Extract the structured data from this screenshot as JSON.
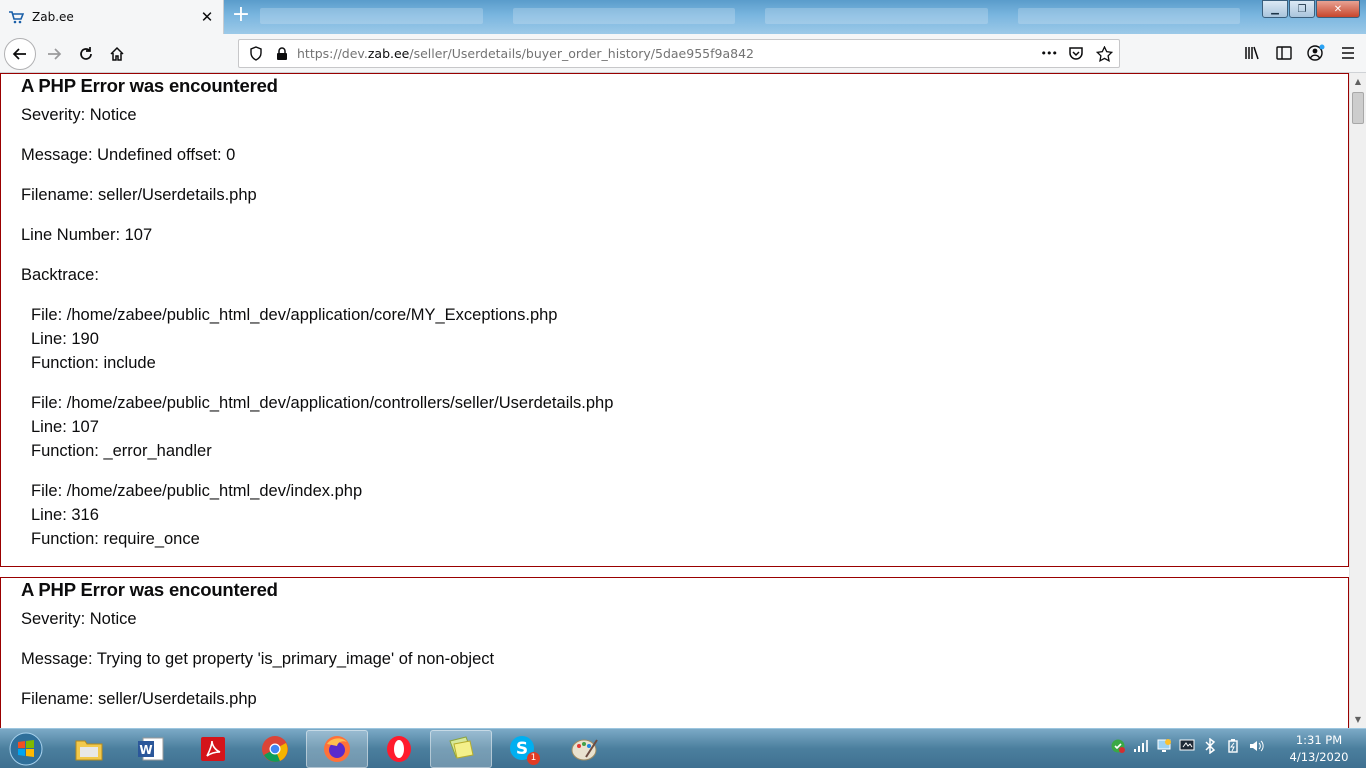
{
  "browser": {
    "tab": {
      "title": "Zab.ee",
      "close": "✕"
    },
    "new_tab": "+",
    "url_prefix": "https://dev.",
    "url_host": "zab.ee",
    "url_path": "/seller/Userdetails/buyer_order_history/5dae955f9a842",
    "url_more": "•••"
  },
  "errors": [
    {
      "heading": "A PHP Error was encountered",
      "severity": "Severity: Notice",
      "message": "Message: Undefined offset: 0",
      "filename": "Filename: seller/Userdetails.php",
      "line_number": "Line Number: 107",
      "backtrace_label": "Backtrace:",
      "backtrace": [
        {
          "file": "File: /home/zabee/public_html_dev/application/core/MY_Exceptions.php",
          "line": "Line: 190",
          "function": "Function: include"
        },
        {
          "file": "File: /home/zabee/public_html_dev/application/controllers/seller/Userdetails.php",
          "line": "Line: 107",
          "function": "Function: _error_handler"
        },
        {
          "file": "File: /home/zabee/public_html_dev/index.php",
          "line": "Line: 316",
          "function": "Function: require_once"
        }
      ]
    },
    {
      "heading": "A PHP Error was encountered",
      "severity": "Severity: Notice",
      "message": "Message: Trying to get property 'is_primary_image' of non-object",
      "filename": "Filename: seller/Userdetails.php"
    }
  ],
  "taskbar": {
    "clock_time": "1:31 PM",
    "clock_date": "4/13/2020",
    "skype_badge": "1"
  },
  "colors": {
    "error_border": "#990000",
    "taskbar": "#4b7f9e",
    "chrome": "#f5f6f7"
  }
}
